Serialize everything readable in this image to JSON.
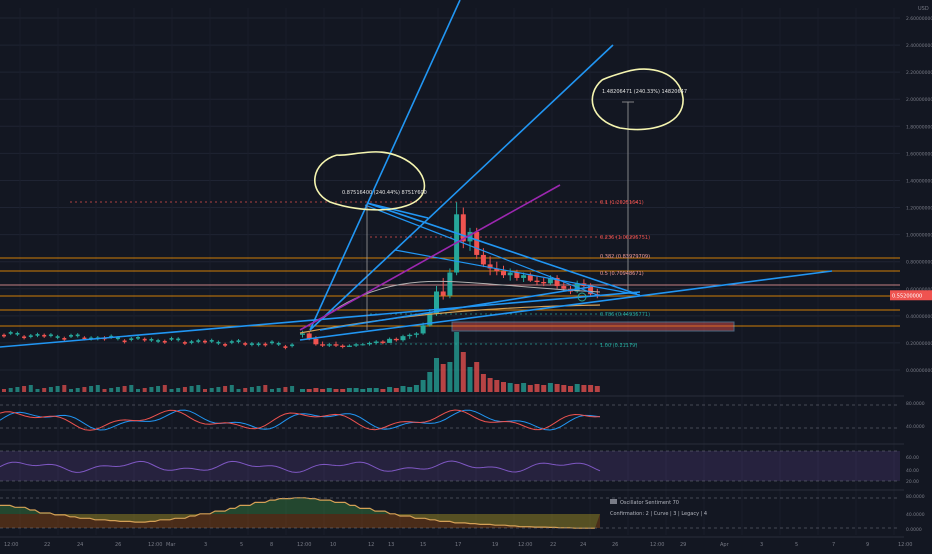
{
  "currency": "USD",
  "price_axis": {
    "ticks": [
      {
        "v": 0.0,
        "label": "0.00000000"
      },
      {
        "v": 0.2,
        "label": "0.20000000"
      },
      {
        "v": 0.4,
        "label": "0.40000000"
      },
      {
        "v": 0.6,
        "label": "0.60000000"
      },
      {
        "v": 0.8,
        "label": "0.80000000"
      },
      {
        "v": 1.0,
        "label": "1.00000000"
      },
      {
        "v": 1.2,
        "label": "1.20000000"
      },
      {
        "v": 1.4,
        "label": "1.40000000"
      },
      {
        "v": 1.6,
        "label": "1.60000000"
      },
      {
        "v": 1.8,
        "label": "1.80000000"
      },
      {
        "v": 2.0,
        "label": "2.00000000"
      },
      {
        "v": 2.2,
        "label": "2.20000000"
      },
      {
        "v": 2.4,
        "label": "2.40000000"
      },
      {
        "v": 2.6,
        "label": "2.60000000"
      }
    ],
    "last_price_label": "0.55200000",
    "last_price_color": "#ef5350"
  },
  "time_axis": [
    "12:00",
    "22",
    "24",
    "26",
    "12:00",
    "Mar",
    "3",
    "5",
    "8",
    "12:00",
    "10",
    "12",
    "13",
    "15",
    "17",
    "19",
    "12:00",
    "22",
    "24",
    "26",
    "12:00",
    "29",
    "Apr",
    "3",
    "5",
    "7",
    "9",
    "12:00"
  ],
  "annotations": {
    "peak_label": "0.87516400 (240.44%) 8751Y600",
    "target_label": "1.48206471 (240.33%) 14820647",
    "fib_levels": [
      {
        "label": "0.1 (1.20251641)",
        "color": "#ef5350"
      },
      {
        "label": "0.236 (1.00295751)",
        "color": "#ef5350"
      },
      {
        "label": "0.382 (0.83979709)",
        "color": "#ef9a9a"
      },
      {
        "label": "0.5 (0.70948671)",
        "color": "#ef9a9a"
      },
      {
        "label": "0.786 (0.44935771)",
        "color": "#26a69a"
      },
      {
        "label": "1.00 (0.21179)",
        "color": "#26a69a"
      }
    ]
  },
  "oscillators": {
    "stoch_ticks": [
      "80.0000",
      "40.0000"
    ],
    "rsi_ticks": [
      "60.00",
      "40.00",
      "20.00"
    ],
    "sentiment_ticks": [
      "80.0000",
      "40.0000",
      "0.0000"
    ],
    "legend_title": "Oscillator Sentiment",
    "legend_value": "70",
    "legend_confirm_label": "Confirmation",
    "legend_confirm_items": [
      "2",
      "Curve",
      "3",
      "Legacy",
      "4"
    ]
  },
  "colors": {
    "background": "#131722",
    "up": "#26a69a",
    "down": "#ef5350",
    "trendline": "#2196f3",
    "purple": "#9c27b0",
    "orange": "#ff9800",
    "highlight": "#f5f5b0"
  },
  "chart_data": {
    "type": "candlestick",
    "interval": "4h",
    "ylim": [
      0,
      2.7
    ],
    "x_range": [
      "Feb 20",
      "Apr 11"
    ],
    "candles": [
      {
        "t": 0,
        "o": 0.26,
        "h": 0.29,
        "l": 0.24,
        "c": 0.27
      },
      {
        "t": 1,
        "o": 0.27,
        "h": 0.28,
        "l": 0.22,
        "c": 0.23
      },
      {
        "t": 2,
        "o": 0.23,
        "h": 0.25,
        "l": 0.18,
        "c": 0.19
      },
      {
        "t": 3,
        "o": 0.19,
        "h": 0.21,
        "l": 0.17,
        "c": 0.18
      },
      {
        "t": 4,
        "o": 0.18,
        "h": 0.2,
        "l": 0.17,
        "c": 0.19
      },
      {
        "t": 5,
        "o": 0.19,
        "h": 0.21,
        "l": 0.17,
        "c": 0.18
      },
      {
        "t": 6,
        "o": 0.18,
        "h": 0.19,
        "l": 0.16,
        "c": 0.17
      },
      {
        "t": 7,
        "o": 0.17,
        "h": 0.19,
        "l": 0.17,
        "c": 0.18
      },
      {
        "t": 8,
        "o": 0.18,
        "h": 0.2,
        "l": 0.17,
        "c": 0.19
      },
      {
        "t": 9,
        "o": 0.19,
        "h": 0.2,
        "l": 0.18,
        "c": 0.19
      },
      {
        "t": 10,
        "o": 0.19,
        "h": 0.21,
        "l": 0.18,
        "c": 0.2
      },
      {
        "t": 11,
        "o": 0.2,
        "h": 0.22,
        "l": 0.19,
        "c": 0.21
      },
      {
        "t": 12,
        "o": 0.21,
        "h": 0.22,
        "l": 0.19,
        "c": 0.2
      },
      {
        "t": 13,
        "o": 0.2,
        "h": 0.24,
        "l": 0.2,
        "c": 0.23
      },
      {
        "t": 14,
        "o": 0.23,
        "h": 0.24,
        "l": 0.21,
        "c": 0.22
      },
      {
        "t": 15,
        "o": 0.22,
        "h": 0.26,
        "l": 0.21,
        "c": 0.25
      },
      {
        "t": 16,
        "o": 0.25,
        "h": 0.27,
        "l": 0.23,
        "c": 0.26
      },
      {
        "t": 17,
        "o": 0.26,
        "h": 0.28,
        "l": 0.24,
        "c": 0.27
      },
      {
        "t": 18,
        "o": 0.27,
        "h": 0.35,
        "l": 0.26,
        "c": 0.33
      },
      {
        "t": 19,
        "o": 0.33,
        "h": 0.45,
        "l": 0.32,
        "c": 0.42
      },
      {
        "t": 20,
        "o": 0.42,
        "h": 0.62,
        "l": 0.4,
        "c": 0.58
      },
      {
        "t": 21,
        "o": 0.58,
        "h": 0.68,
        "l": 0.52,
        "c": 0.55
      },
      {
        "t": 22,
        "o": 0.55,
        "h": 0.75,
        "l": 0.53,
        "c": 0.72
      },
      {
        "t": 23,
        "o": 0.72,
        "h": 1.24,
        "l": 0.7,
        "c": 1.15
      },
      {
        "t": 24,
        "o": 1.15,
        "h": 1.2,
        "l": 0.9,
        "c": 0.95
      },
      {
        "t": 25,
        "o": 0.95,
        "h": 1.05,
        "l": 0.88,
        "c": 1.02
      },
      {
        "t": 26,
        "o": 1.02,
        "h": 1.05,
        "l": 0.82,
        "c": 0.85
      },
      {
        "t": 27,
        "o": 0.85,
        "h": 0.9,
        "l": 0.76,
        "c": 0.78
      },
      {
        "t": 28,
        "o": 0.78,
        "h": 0.84,
        "l": 0.7,
        "c": 0.75
      },
      {
        "t": 29,
        "o": 0.75,
        "h": 0.8,
        "l": 0.7,
        "c": 0.73
      },
      {
        "t": 30,
        "o": 0.73,
        "h": 0.77,
        "l": 0.68,
        "c": 0.7
      },
      {
        "t": 31,
        "o": 0.7,
        "h": 0.75,
        "l": 0.66,
        "c": 0.72
      },
      {
        "t": 32,
        "o": 0.72,
        "h": 0.74,
        "l": 0.66,
        "c": 0.68
      },
      {
        "t": 33,
        "o": 0.68,
        "h": 0.72,
        "l": 0.65,
        "c": 0.7
      },
      {
        "t": 34,
        "o": 0.7,
        "h": 0.72,
        "l": 0.65,
        "c": 0.66
      },
      {
        "t": 35,
        "o": 0.66,
        "h": 0.69,
        "l": 0.63,
        "c": 0.65
      },
      {
        "t": 36,
        "o": 0.65,
        "h": 0.68,
        "l": 0.62,
        "c": 0.64
      },
      {
        "t": 37,
        "o": 0.64,
        "h": 0.7,
        "l": 0.63,
        "c": 0.68
      },
      {
        "t": 38,
        "o": 0.68,
        "h": 0.7,
        "l": 0.6,
        "c": 0.62
      },
      {
        "t": 39,
        "o": 0.62,
        "h": 0.66,
        "l": 0.58,
        "c": 0.6
      },
      {
        "t": 40,
        "o": 0.6,
        "h": 0.62,
        "l": 0.56,
        "c": 0.58
      },
      {
        "t": 41,
        "o": 0.58,
        "h": 0.66,
        "l": 0.57,
        "c": 0.64
      },
      {
        "t": 42,
        "o": 0.64,
        "h": 0.67,
        "l": 0.6,
        "c": 0.62
      },
      {
        "t": 43,
        "o": 0.62,
        "h": 0.64,
        "l": 0.55,
        "c": 0.56
      },
      {
        "t": 44,
        "o": 0.56,
        "h": 0.6,
        "l": 0.53,
        "c": 0.55
      }
    ],
    "volume": [
      3,
      3,
      4,
      3,
      4,
      3,
      3,
      4,
      4,
      3,
      4,
      4,
      3,
      5,
      4,
      6,
      5,
      7,
      12,
      20,
      34,
      28,
      30,
      60,
      40,
      25,
      30,
      18,
      14,
      12,
      10,
      9,
      8,
      9,
      7,
      8,
      7,
      9,
      8,
      7,
      6,
      8,
      7,
      7,
      6
    ],
    "stoch_rsi": [
      60,
      45,
      35,
      40,
      55,
      50,
      42,
      48,
      55,
      62,
      58,
      50,
      45,
      55,
      65,
      72,
      80,
      82,
      85,
      90,
      92,
      88,
      80,
      85,
      70,
      60,
      55,
      45,
      40,
      50,
      55,
      48,
      42,
      50,
      55,
      48,
      40,
      35,
      45,
      55,
      62,
      70,
      60,
      50,
      42
    ],
    "oscillator_sentiment": [
      70,
      65,
      58,
      50,
      45,
      40,
      36,
      32,
      30,
      28,
      26,
      28,
      32,
      36,
      42,
      48,
      55,
      62,
      70,
      78,
      84,
      88,
      90,
      88,
      84,
      78,
      70,
      62,
      55,
      48,
      42,
      36,
      32,
      28,
      24,
      22,
      20,
      18,
      16,
      14,
      13,
      12,
      11,
      10,
      10
    ]
  }
}
